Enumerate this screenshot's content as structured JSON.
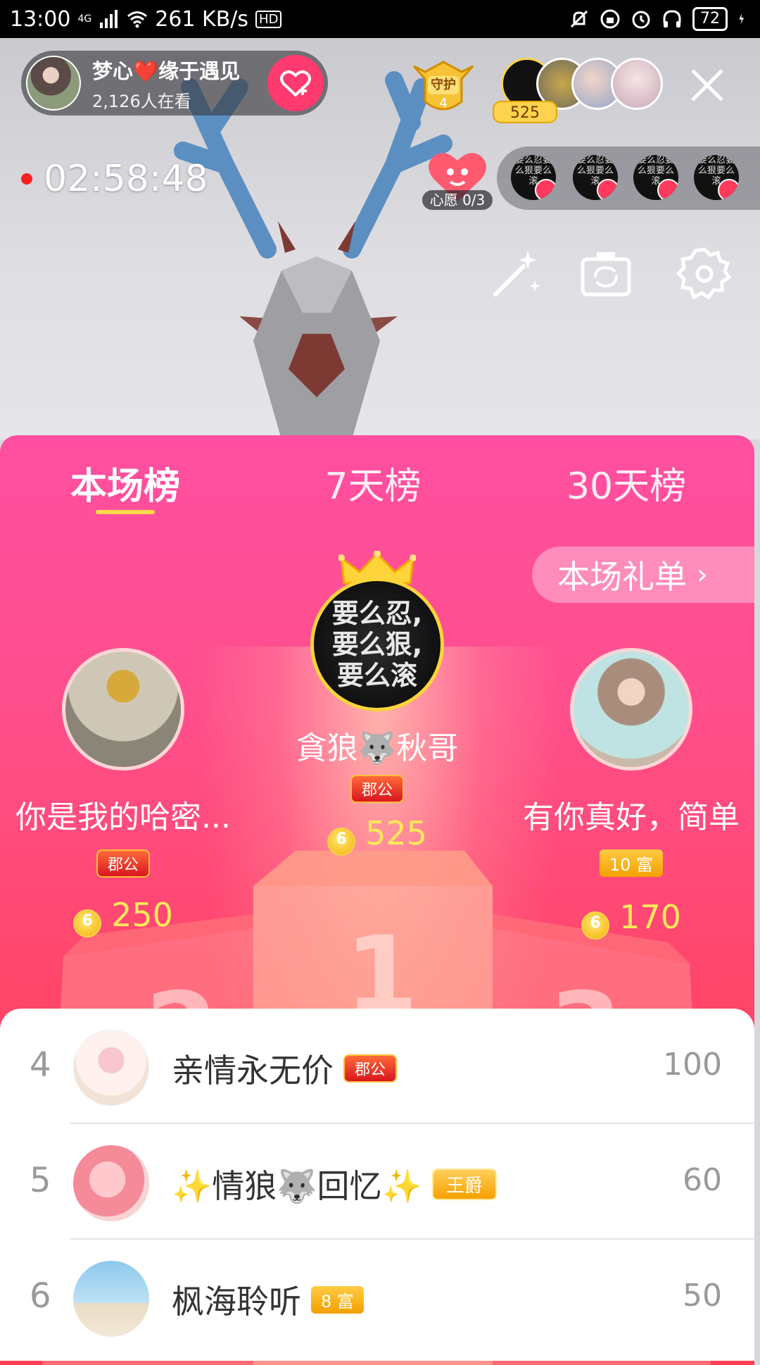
{
  "status_bar": {
    "time": "13:00",
    "network": "4G",
    "speed": "261 KB/s",
    "hd": "HD",
    "battery": "72"
  },
  "host": {
    "name": "梦心❤️缘于遇见",
    "viewers": "2,126人在看"
  },
  "guard": {
    "label": "守护",
    "count": "4"
  },
  "audience": {
    "count": "525"
  },
  "stream": {
    "elapsed": "02:58:48"
  },
  "wish": {
    "label": "心愿 0/3"
  },
  "seats": [
    {
      "text": "要么忍要么狠要么滚"
    },
    {
      "text": "要么忍要么狠要么滚"
    },
    {
      "text": "要么忍要么狠要么滚"
    },
    {
      "text": "要么忍要么狠要么滚"
    }
  ],
  "board": {
    "tabs": [
      "本场榜",
      "7天榜",
      "30天榜"
    ],
    "active_tab": 0,
    "gift_list_label": "本场礼单",
    "first": {
      "name": "貪狼🐺秋哥",
      "badge": "郡公",
      "score": "525",
      "avatar_text": "要么忍,\n要么狠,\n要么滚"
    },
    "second": {
      "name": "你是我的哈密...",
      "badge": "郡公",
      "score": "250"
    },
    "third": {
      "name": "有你真好，简单",
      "badge": "10 富",
      "score": "170"
    },
    "podium_numbers": [
      "1",
      "2",
      "3"
    ]
  },
  "list": [
    {
      "rank": "4",
      "name": "亲情永无价",
      "badge": "郡公",
      "score": "100"
    },
    {
      "rank": "5",
      "name": "✨情狼🐺回忆✨",
      "badge": "王爵",
      "score": "60"
    },
    {
      "rank": "6",
      "name": "枫海聆听",
      "badge": "8 富",
      "score": "50"
    }
  ],
  "colors": {
    "panel_top": "#ff4fa1",
    "panel_bottom": "#ff3e55",
    "score_yellow": "#ffe95a",
    "follow_pink": "#fe3a6e"
  }
}
